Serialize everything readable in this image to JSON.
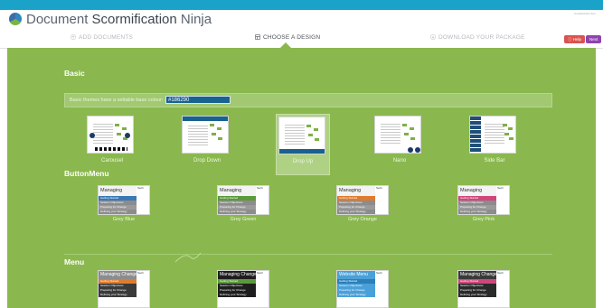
{
  "app": {
    "title_light": "Document ",
    "title_bold": "Scormification",
    "title_end": " Ninja",
    "support": "Contact/Help Tour"
  },
  "steps": [
    {
      "label": "ADD DOCUMENTS"
    },
    {
      "label": "CHOOSE A DESIGN"
    },
    {
      "label": "DOWNLOAD YOUR PACKAGE"
    }
  ],
  "header_buttons": {
    "help": "Help",
    "next": "Next"
  },
  "colors": {
    "accent": "#186290",
    "main_bg": "#8ab84e",
    "topbar": "#1ba2c8"
  },
  "sections": {
    "basic": {
      "title": "Basic",
      "note": "Basic themes have a settable base colour:",
      "base_colour": "#186290",
      "themes": [
        {
          "label": "Carousel"
        },
        {
          "label": "Drop Down"
        },
        {
          "label": "Drop Up",
          "selected": true
        },
        {
          "label": "Nano"
        },
        {
          "label": "Side Bar"
        }
      ]
    },
    "button_menu": {
      "title": "ButtonMenu",
      "card_title": "Managing Change",
      "side_text": "Secti",
      "rows": [
        "Getting Started",
        "Session Objectives",
        "Preparing for Change",
        "Defining your Strategy"
      ],
      "themes": [
        {
          "label": "Grey Blue",
          "accent": "#3a78b5"
        },
        {
          "label": "Grey Green",
          "accent": "#5a9a3a"
        },
        {
          "label": "Grey Orange",
          "accent": "#e07b2c"
        },
        {
          "label": "Grey Pink",
          "accent": "#d0457a"
        }
      ]
    },
    "menu": {
      "title": "Menu",
      "cards": [
        {
          "title": "Managing Change",
          "head": "#8c8c8c",
          "row_bg": "#3a3a3a",
          "accent": "#e07b2c"
        },
        {
          "title": "Managing Change",
          "head": "#1e1e1e",
          "row_bg": "#1e1e1e",
          "accent": "#5a9a3a"
        },
        {
          "title": "Website Menu",
          "head": "#4aa0d8",
          "row_bg": "#4aa0d8",
          "accent": "#2c7fb8"
        },
        {
          "title": "Managing Change",
          "head": "#3a3a3a",
          "row_bg": "#2a2a2a",
          "accent": "#d0457a"
        }
      ]
    }
  }
}
